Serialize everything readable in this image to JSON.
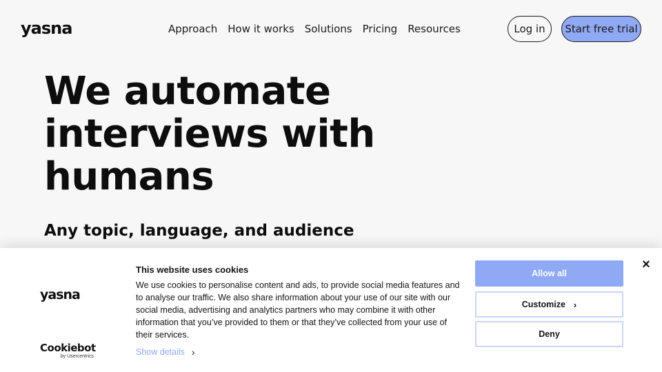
{
  "header": {
    "logo": "yasna",
    "nav": [
      "Approach",
      "How it works",
      "Solutions",
      "Pricing",
      "Resources"
    ],
    "login_label": "Log in",
    "trial_label": "Start free trial"
  },
  "hero": {
    "title_lines": [
      "We automate",
      "interviews with",
      "humans"
    ],
    "subtitle": "Any topic, language, and audience"
  },
  "cookie_banner": {
    "logo": "yasna",
    "provider_name": "Cookiebot",
    "provider_by": "by Usercentrics",
    "title": "This website uses cookies",
    "body": "We use cookies to personalise content and ads, to provide social media features and to analyse our traffic. We also share information about your use of our site with our social media, advertising and analytics partners who may combine it with other information that you’ve provided to them or that they’ve collected from your use of their services.",
    "show_details_label": "Show details",
    "allow_all_label": "Allow all",
    "customize_label": "Customize",
    "deny_label": "Deny",
    "close_icon": "×",
    "colors": {
      "accent": "#8fa9f5",
      "border": "#c9d5f8"
    }
  }
}
